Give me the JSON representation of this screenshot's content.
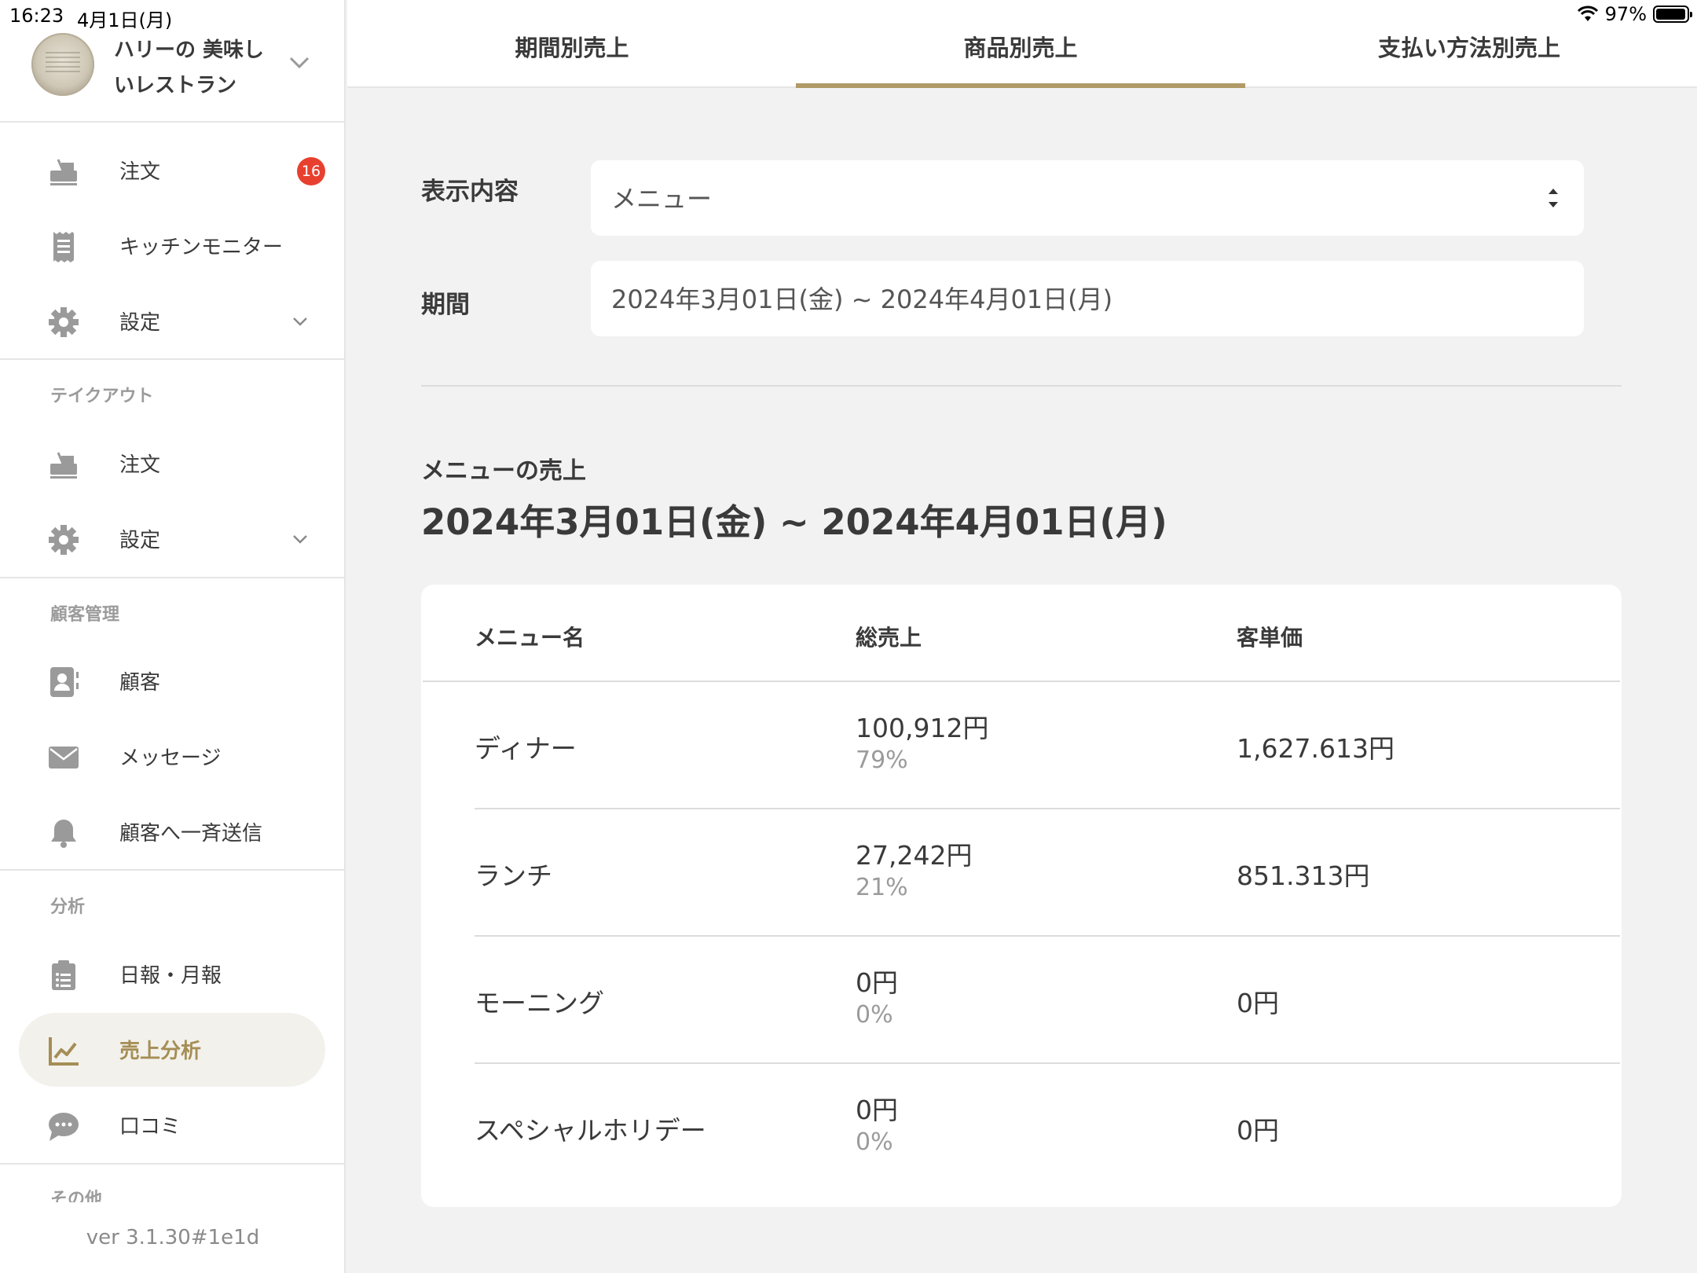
{
  "status": {
    "time": "16:23",
    "date": "4月1日(月)",
    "battery": "97%"
  },
  "store": {
    "name": "ハリーの 美味しいレストラン"
  },
  "nav": {
    "order": {
      "label": "注文",
      "badge": "16"
    },
    "kitchen": {
      "label": "キッチンモニター"
    },
    "settings": {
      "label": "設定"
    },
    "takeout_title": "テイクアウト",
    "takeout_order": {
      "label": "注文"
    },
    "takeout_settings": {
      "label": "設定"
    },
    "customer_title": "顧客管理",
    "customers": {
      "label": "顧客"
    },
    "messages": {
      "label": "メッセージ"
    },
    "broadcast": {
      "label": "顧客へ一斉送信"
    },
    "analysis_title": "分析",
    "reports": {
      "label": "日報・月報"
    },
    "sales_analysis": {
      "label": "売上分析"
    },
    "reviews": {
      "label": "口コミ"
    },
    "other_title": "その他"
  },
  "version": "ver 3.1.30#1e1d",
  "tabs": [
    {
      "label": "期間別売上",
      "active": false
    },
    {
      "label": "商品別売上",
      "active": true
    },
    {
      "label": "支払い方法別売上",
      "active": false
    }
  ],
  "form": {
    "display_label": "表示内容",
    "display_value": "メニュー",
    "period_label": "期間",
    "period_value": "2024年3月01日(金) ~ 2024年4月01日(月)"
  },
  "sales": {
    "title": "メニューの売上",
    "range": "2024年3月01日(金) ~ 2024年4月01日(月)",
    "headers": {
      "name": "メニュー名",
      "total": "総売上",
      "unit": "客単価"
    },
    "rows": [
      {
        "name": "ディナー",
        "total": "100,912円",
        "pct": "79%",
        "unit": "1,627.613円"
      },
      {
        "name": "ランチ",
        "total": "27,242円",
        "pct": "21%",
        "unit": "851.313円"
      },
      {
        "name": "モーニング",
        "total": "0円",
        "pct": "0%",
        "unit": "0円"
      },
      {
        "name": "スペシャルホリデー",
        "total": "0円",
        "pct": "0%",
        "unit": "0円"
      }
    ]
  },
  "colors": {
    "accent": "#b09a66",
    "badge": "#e8402f",
    "icon": "#9a9a9a"
  }
}
